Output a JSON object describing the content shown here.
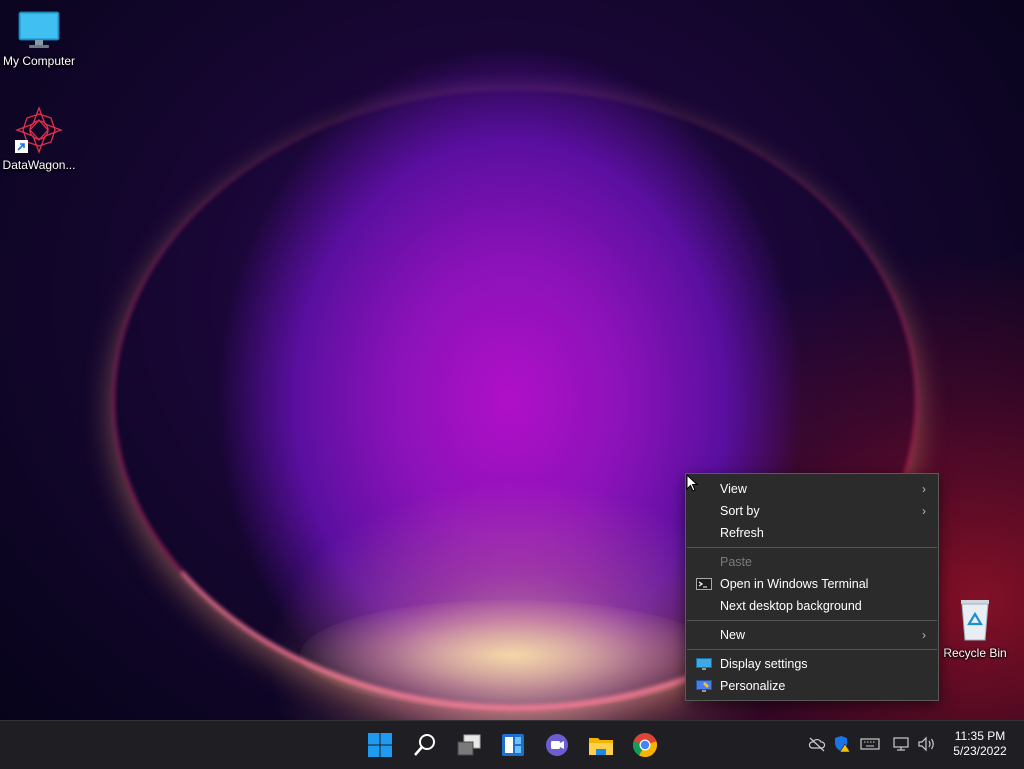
{
  "desktop": {
    "icons": [
      {
        "label": "My Computer"
      },
      {
        "label": "DataWagon..."
      },
      {
        "label": "Recycle Bin"
      }
    ]
  },
  "context_menu": {
    "items": [
      {
        "label": "View",
        "submenu": true
      },
      {
        "label": "Sort by",
        "submenu": true
      },
      {
        "label": "Refresh"
      },
      {
        "label": "Paste",
        "disabled": true
      },
      {
        "label": "Open in Windows Terminal",
        "icon": "terminal-icon"
      },
      {
        "label": "Next desktop background"
      },
      {
        "label": "New",
        "submenu": true
      },
      {
        "label": "Display settings",
        "icon": "display-settings-icon"
      },
      {
        "label": "Personalize",
        "icon": "personalize-icon"
      }
    ]
  },
  "taskbar": {
    "apps": [
      {
        "name": "start-icon"
      },
      {
        "name": "search-icon"
      },
      {
        "name": "task-view-icon"
      },
      {
        "name": "widgets-icon"
      },
      {
        "name": "chat-icon"
      },
      {
        "name": "file-explorer-icon"
      },
      {
        "name": "chrome-icon"
      }
    ],
    "tray_icons": [
      "onedrive-offline-icon",
      "security-warning-icon",
      "keyboard-icon",
      "network-icon",
      "volume-icon"
    ],
    "time": "11:35 PM",
    "date": "5/23/2022"
  },
  "colors": {
    "menu_bg": "#2b2b2b",
    "taskbar_bg": "#1f1f23",
    "accent": "#0078d4"
  }
}
